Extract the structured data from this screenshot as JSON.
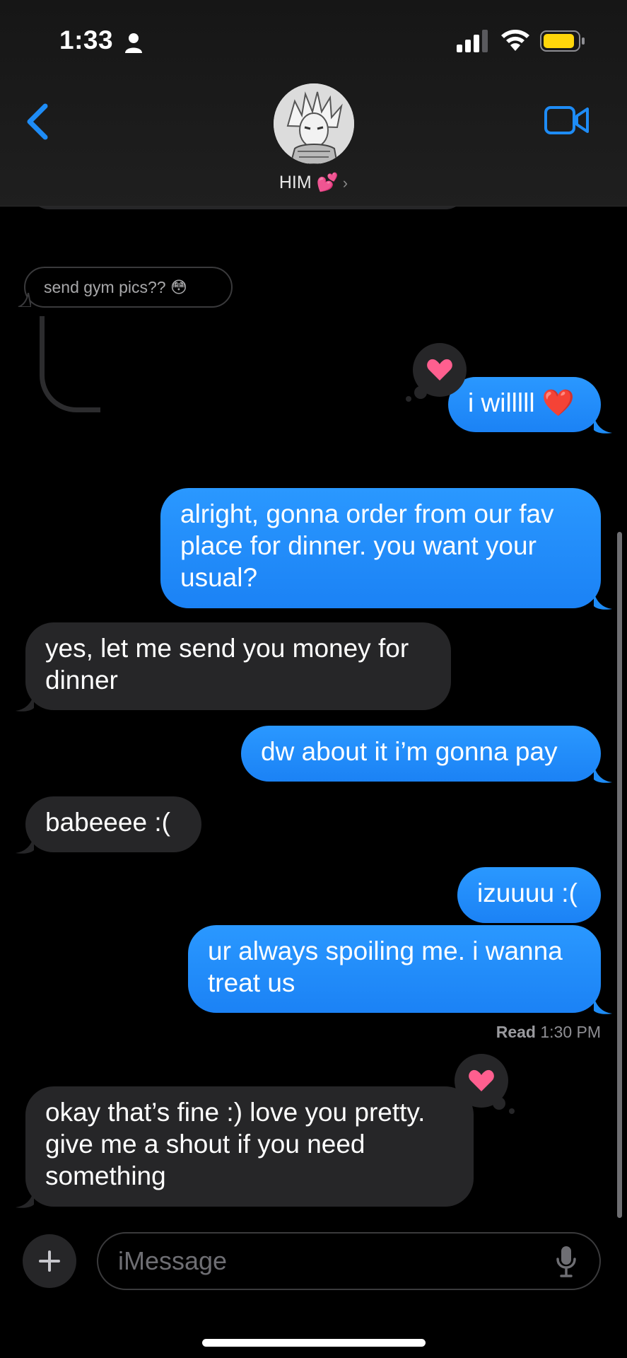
{
  "status_bar": {
    "time": "1:33"
  },
  "header": {
    "contact_name": "HIM 💕",
    "chevron": "›"
  },
  "reply": {
    "quoted_text": "send gym pics?? 😳"
  },
  "messages": [
    {
      "id": "m1",
      "side": "sent",
      "text": "i willlll ❤️"
    },
    {
      "id": "m2",
      "side": "sent",
      "text": "alright, gonna order from our fav\nplace for dinner. you want your\nusual?"
    },
    {
      "id": "m3",
      "side": "recv",
      "text": "yes, let me send you money for\ndinner"
    },
    {
      "id": "m4",
      "side": "sent",
      "text": "dw about it i’m gonna pay"
    },
    {
      "id": "m5",
      "side": "recv",
      "text": "babeeee :("
    },
    {
      "id": "m6",
      "side": "sent",
      "text": "izuuuu :("
    },
    {
      "id": "m7",
      "side": "sent",
      "text": "ur always spoiling me. i wanna\ntreat us"
    },
    {
      "id": "m8",
      "side": "recv",
      "text": "okay that’s fine :) love you pretty.\ngive me a shout if you need\nsomething"
    }
  ],
  "read_receipt": {
    "label": "Read",
    "time": "1:30 PM"
  },
  "composer": {
    "placeholder": "iMessage"
  },
  "colors": {
    "sent_bubble": "#1e8cf6",
    "recv_bubble": "#262628",
    "accent": "#1e8cf6",
    "heart": "#ff5f8f",
    "battery": "#ffd60a"
  },
  "icons": [
    "person-icon",
    "signal-icon",
    "wifi-icon",
    "battery-icon",
    "back-chevron-icon",
    "video-icon",
    "heart-icon",
    "plus-icon",
    "mic-icon"
  ]
}
